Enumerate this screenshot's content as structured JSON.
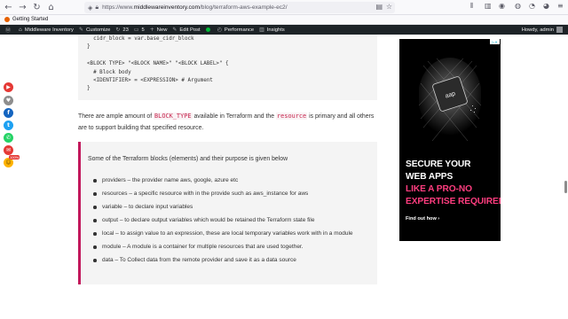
{
  "browser": {
    "url_prefix": "https://www.",
    "url_domain": "middlewareinventory.com",
    "url_path": "/blog/terraform-aws-example-ec2/",
    "bookmark_label": "Getting Started",
    "icons": [
      "back-icon",
      "forward-icon",
      "reload-icon",
      "home-icon",
      "shield-icon",
      "lock-icon",
      "reader-icon",
      "bookmark-star-icon",
      "library-icon",
      "sidebar-icon",
      "account-icon",
      "extension-icon",
      "menu-icon"
    ]
  },
  "adminbar": {
    "site_name": "Middleware Inventory",
    "customize": "Customize",
    "updates_count": "23",
    "comments_count": "5",
    "new_label": "New",
    "edit_post": "Edit Post",
    "performance": "Performance",
    "insights": "Insights",
    "greeting": "Howdy, admin"
  },
  "code": {
    "lines": [
      "  cidr_block = var.base_cidr_block",
      "}",
      "",
      "<BLOCK TYPE> \"<BLOCK NAME>\" \"<BLOCK LABEL>\" {",
      "  # Block body",
      "  <IDENTIFIER> = <EXPRESSION> # Argument",
      "}"
    ]
  },
  "paragraph": {
    "part1": "There are ample amount of ",
    "code1": "BLOCK_TYPE",
    "part2": " available in Terraform and the ",
    "code2": "resource",
    "part3": " is primary and all others are to support building that specified resource."
  },
  "quote": {
    "intro": "Some of the Terraform blocks (elements) and their purpose is given below",
    "items": [
      "providers – the provider name aws, google, azure etc",
      "resources – a specific resource with in the provide such as aws_instance for aws",
      "variable – to declare input variables",
      "output – to declare output variables which would be retained the Terraform state file",
      "local – to assign value to an expression, these are local temporary variables work with in a module",
      "module – A module is a container for multiple resources that are used together.",
      "data – To Collect data from the remote provider and save it as a data source"
    ]
  },
  "ad": {
    "chip_label": "aap",
    "line1": "SECURE YOUR",
    "line2": "WEB APPS",
    "line3": "LIKE A PRO-NO",
    "line4": "EXPERTISE REQUIRED",
    "cta": "Find out how ›",
    "colors": {
      "white": "#ffffff",
      "pink": "#ff3d7f"
    }
  },
  "share": {
    "count": "100%",
    "colors": [
      "#e53935",
      "#8e8e8e",
      "#1565c0",
      "#1da1f2",
      "#25d366",
      "#e53935",
      "#ffb300"
    ]
  }
}
